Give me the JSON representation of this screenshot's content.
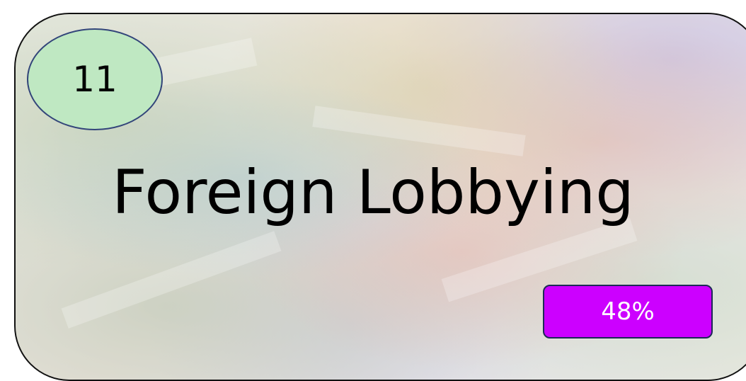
{
  "badge": {
    "number": "11",
    "color": "#bfe8c2"
  },
  "title": "Foreign Lobbying",
  "percent": {
    "label": "48%",
    "color": "#cc00ff"
  }
}
